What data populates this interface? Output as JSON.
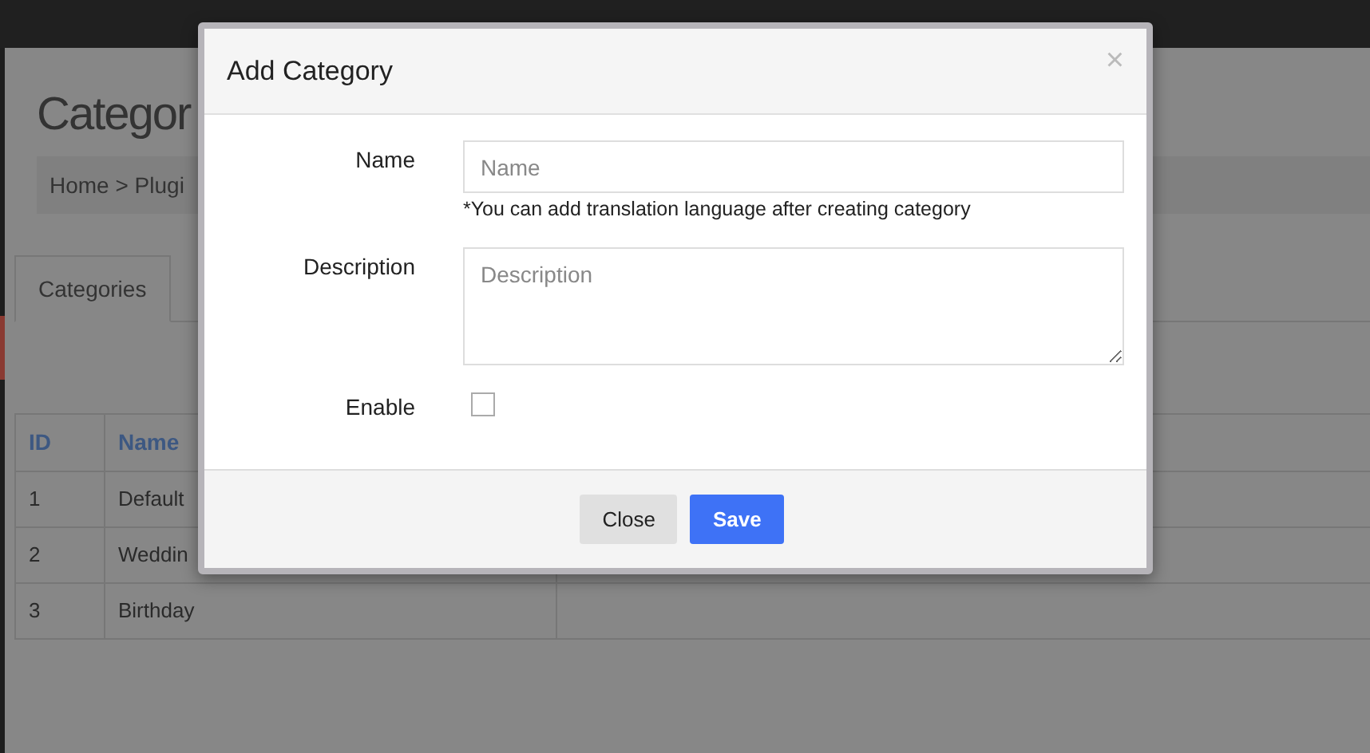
{
  "page": {
    "heading": "Categor",
    "breadcrumb": "Home > Plugi",
    "tabs": [
      {
        "label": "Categories",
        "selected": true
      }
    ],
    "table": {
      "columns": [
        "ID",
        "Name"
      ],
      "rows": [
        {
          "id": "1",
          "name": "Default"
        },
        {
          "id": "2",
          "name": "Weddin"
        },
        {
          "id": "3",
          "name": "Birthday"
        }
      ]
    }
  },
  "dialog": {
    "title": "Add Category",
    "close_icon": "×",
    "fields": [
      {
        "kind": "input",
        "label": "Name",
        "placeholder": "Name",
        "hint": "*You can add translation language after creating category"
      },
      {
        "kind": "textarea",
        "label": "Description",
        "placeholder": "Description"
      },
      {
        "kind": "checkbox",
        "label": "Enable",
        "checked": false
      }
    ],
    "buttons": [
      {
        "label": "Close",
        "kind": "secondary"
      },
      {
        "label": "Save",
        "kind": "primary"
      }
    ]
  }
}
